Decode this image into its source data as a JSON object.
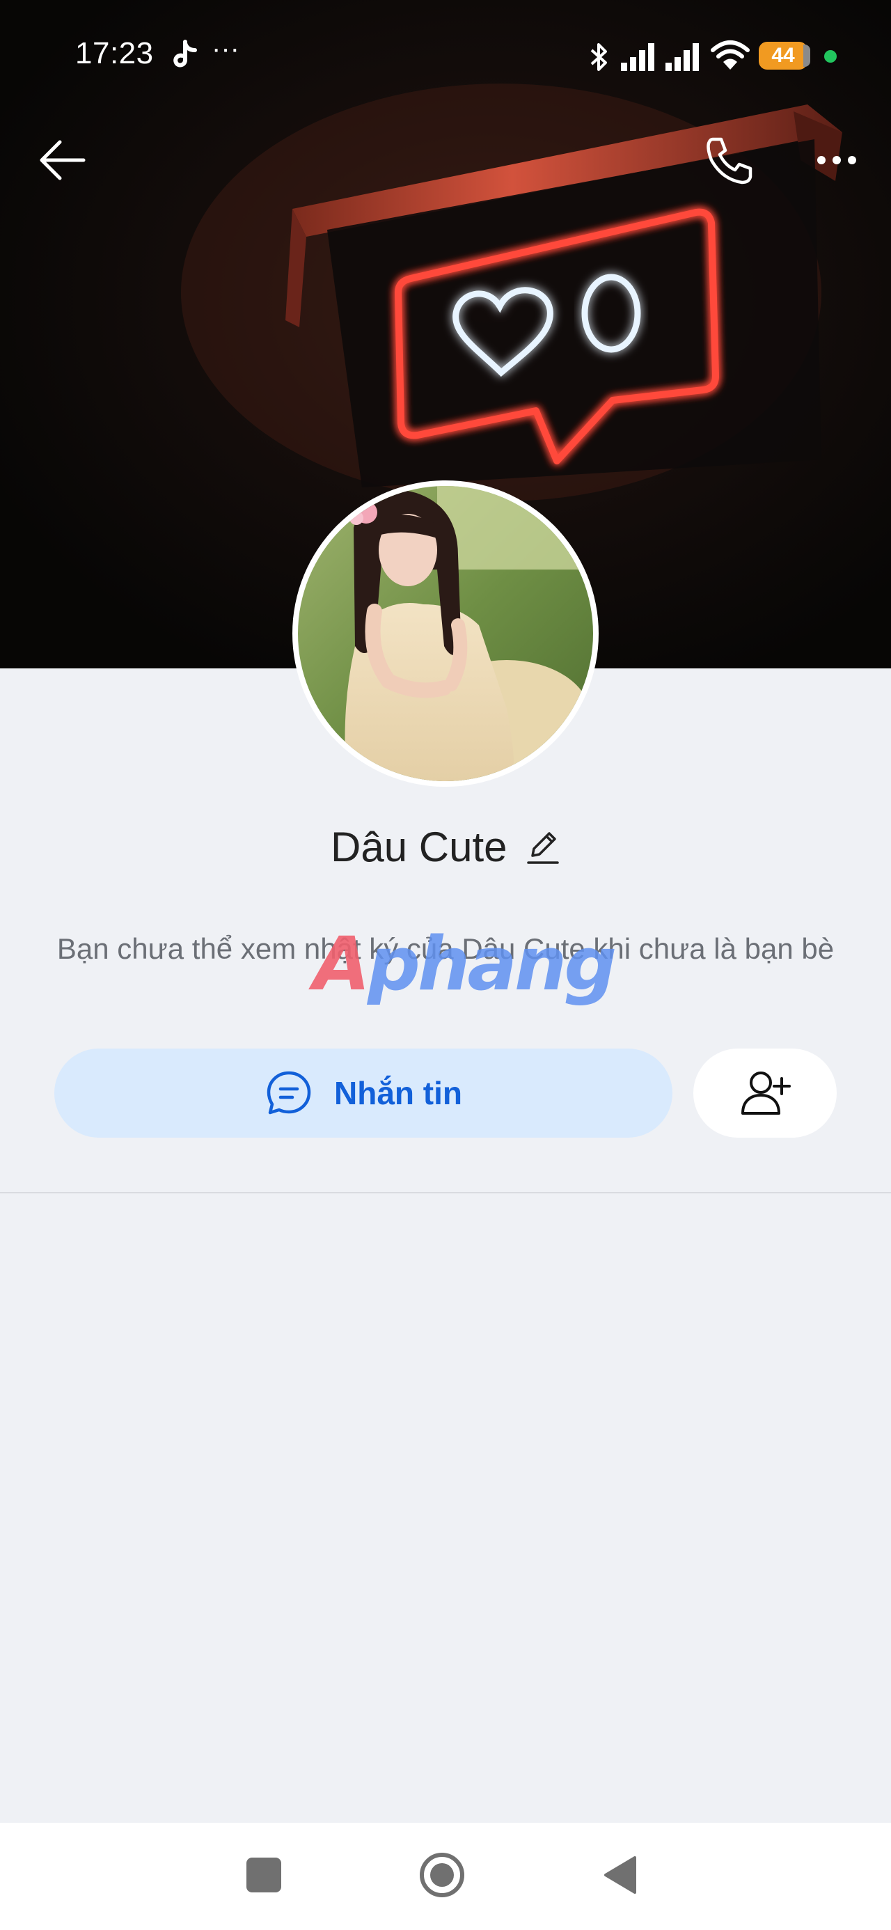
{
  "status_bar": {
    "time": "17:23",
    "more": "···",
    "battery": "44",
    "icons": [
      "tiktok-icon",
      "bluetooth-icon",
      "signal-icon",
      "signal-icon",
      "wifi-icon",
      "battery-icon",
      "privacy-dot"
    ]
  },
  "header": {
    "back_icon": "arrow-left-icon",
    "call_icon": "phone-icon",
    "more_icon": "more-horizontal-icon"
  },
  "profile": {
    "name": "Dâu Cute",
    "edit_icon": "pencil-icon",
    "notice": "Bạn chưa thể xem nhật ký của Dâu Cute khi chưa là bạn bè"
  },
  "watermark": {
    "first": "A",
    "rest": "phang"
  },
  "actions": {
    "message_label": "Nhắn tin",
    "message_icon": "chat-bubble-icon",
    "add_friend_icon": "user-plus-icon"
  },
  "nav_bar": {
    "icons": [
      "recents-square-icon",
      "home-circle-icon",
      "back-triangle-icon"
    ]
  },
  "colors": {
    "background": "#eff1f5",
    "accent": "#1260d9",
    "message_button_bg": "#d9eafd",
    "battery": "#f19a21",
    "neon_red": "#ff4a3a",
    "neon_white": "#e8f4ff"
  }
}
